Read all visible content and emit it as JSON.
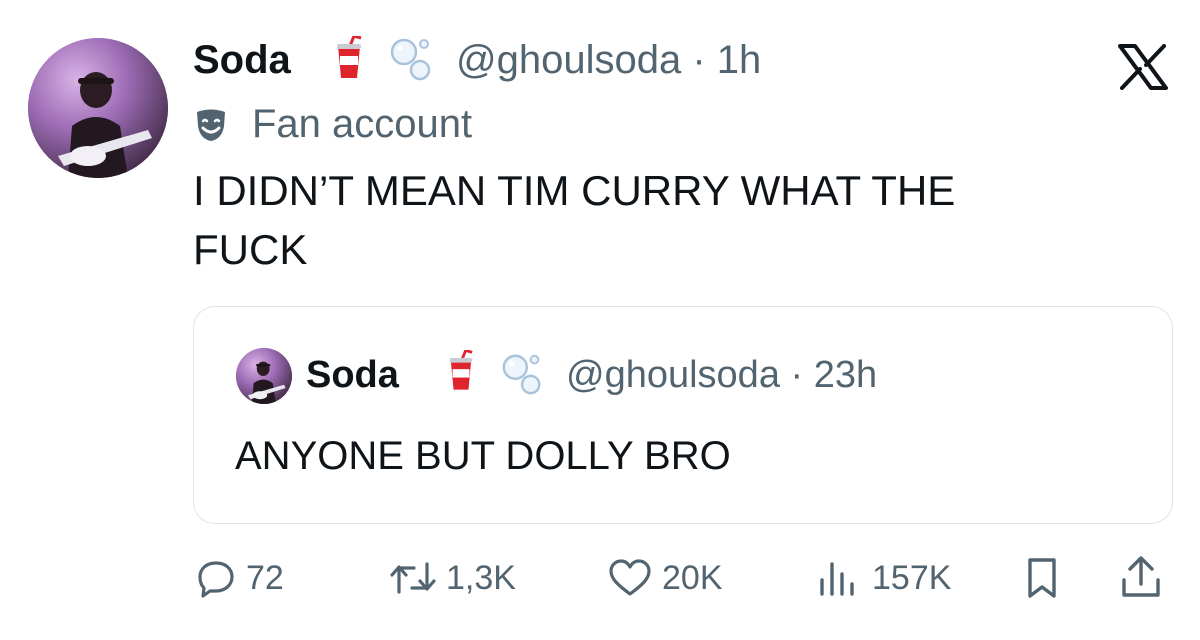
{
  "tweet": {
    "author_name": "Soda",
    "handle": "@ghoulsoda",
    "separator": "·",
    "time": "1h",
    "label": "Fan account",
    "text_line1": "I DIDN’T MEAN TIM CURRY WHAT THE",
    "text_line2": "FUCK"
  },
  "quoted": {
    "author_name": "Soda",
    "handle": "@ghoulsoda",
    "separator": "·",
    "time": "23h",
    "text": "ANYONE BUT DOLLY BRO"
  },
  "actions": {
    "replies": "72",
    "retweets": "1,3K",
    "likes": "20K",
    "views": "157K"
  },
  "icons": {
    "brand": "x-logo-icon",
    "name_emoji_1": "cup-with-straw-icon",
    "name_emoji_2": "bubbles-icon",
    "label_icon": "performing-arts-mask-icon",
    "reply": "reply-icon",
    "retweet": "retweet-icon",
    "like": "heart-icon",
    "views": "views-icon",
    "bookmark": "bookmark-icon",
    "share": "share-icon"
  },
  "colors": {
    "text": "#0f1419",
    "secondary": "#536471",
    "border": "#dfe3e6",
    "cup_red": "#e0242e"
  }
}
